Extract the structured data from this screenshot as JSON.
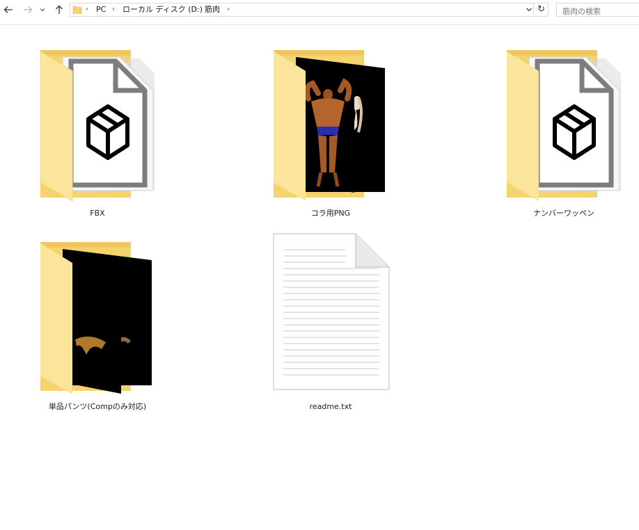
{
  "address_bar": {
    "breadcrumbs": [
      "PC",
      "ローカル ディスク (D:)",
      "筋肉"
    ]
  },
  "search": {
    "placeholder": "筋肉の検索"
  },
  "items": [
    {
      "name": "FBX",
      "type": "folder",
      "preview": "3d-object-icon"
    },
    {
      "name": "コラ用PNG",
      "type": "folder",
      "preview": "bodybuilder-images"
    },
    {
      "name": "ナンバーワッペン",
      "type": "folder",
      "preview": "3d-object-icon"
    },
    {
      "name": "単品パンツ(Compのみ対応)",
      "type": "folder",
      "preview": "dark-images"
    },
    {
      "name": "readme.txt",
      "type": "text-file",
      "preview": "text-file-icon"
    }
  ],
  "colors": {
    "folder_back": "#f5d36f",
    "folder_front": "#fbe59b",
    "accent_border": "#d9d9d9"
  }
}
